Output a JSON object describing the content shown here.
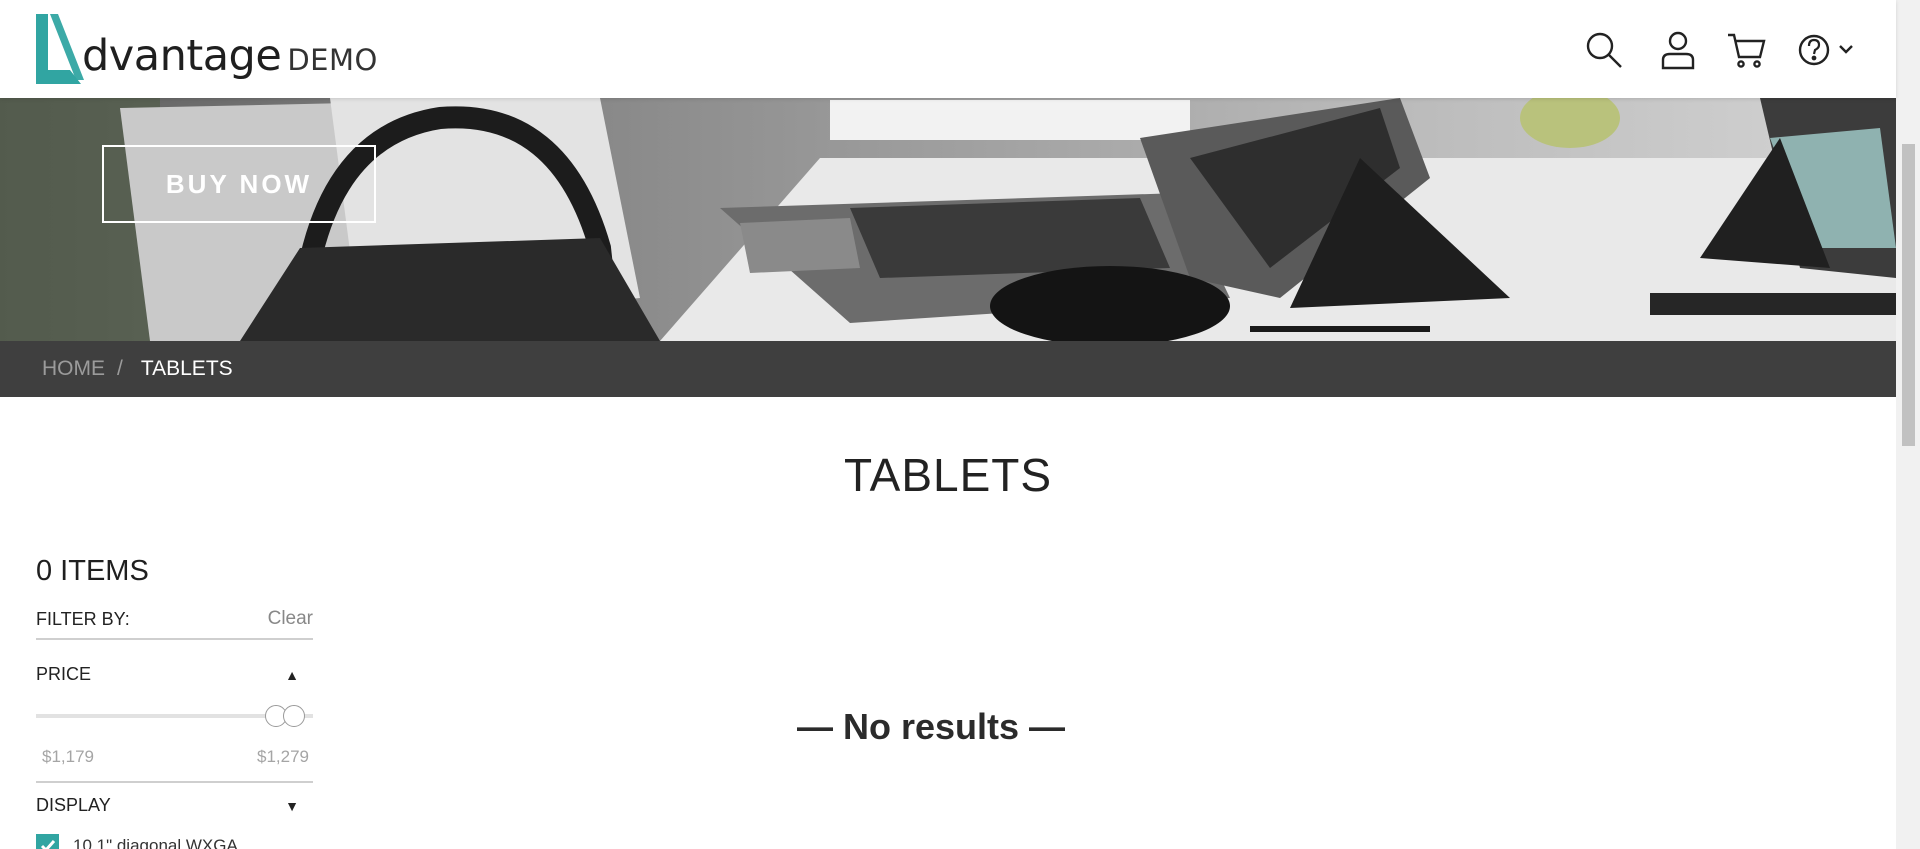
{
  "header": {
    "logo_word": "dvantage",
    "logo_demo": "DEMO",
    "icons": [
      "search-icon",
      "user-icon",
      "cart-icon",
      "help-icon",
      "chevron-down-icon"
    ],
    "accent_color": "#31a5a2"
  },
  "hero": {
    "buy_now_label": "BUY NOW"
  },
  "breadcrumb": {
    "home": "HOME",
    "separator": "/",
    "current": "TABLETS"
  },
  "page_title": "TABLETS",
  "filters": {
    "items_count": "0 ITEMS",
    "filter_by": "FILTER BY:",
    "clear_label": "Clear",
    "price": {
      "label": "PRICE",
      "min": "$1,179",
      "max": "$1,279"
    },
    "display": {
      "label": "DISPLAY",
      "options": [
        {
          "label": "10.1\" diagonal WXGA",
          "checked": true
        }
      ]
    }
  },
  "results": {
    "message": "— No results —"
  }
}
